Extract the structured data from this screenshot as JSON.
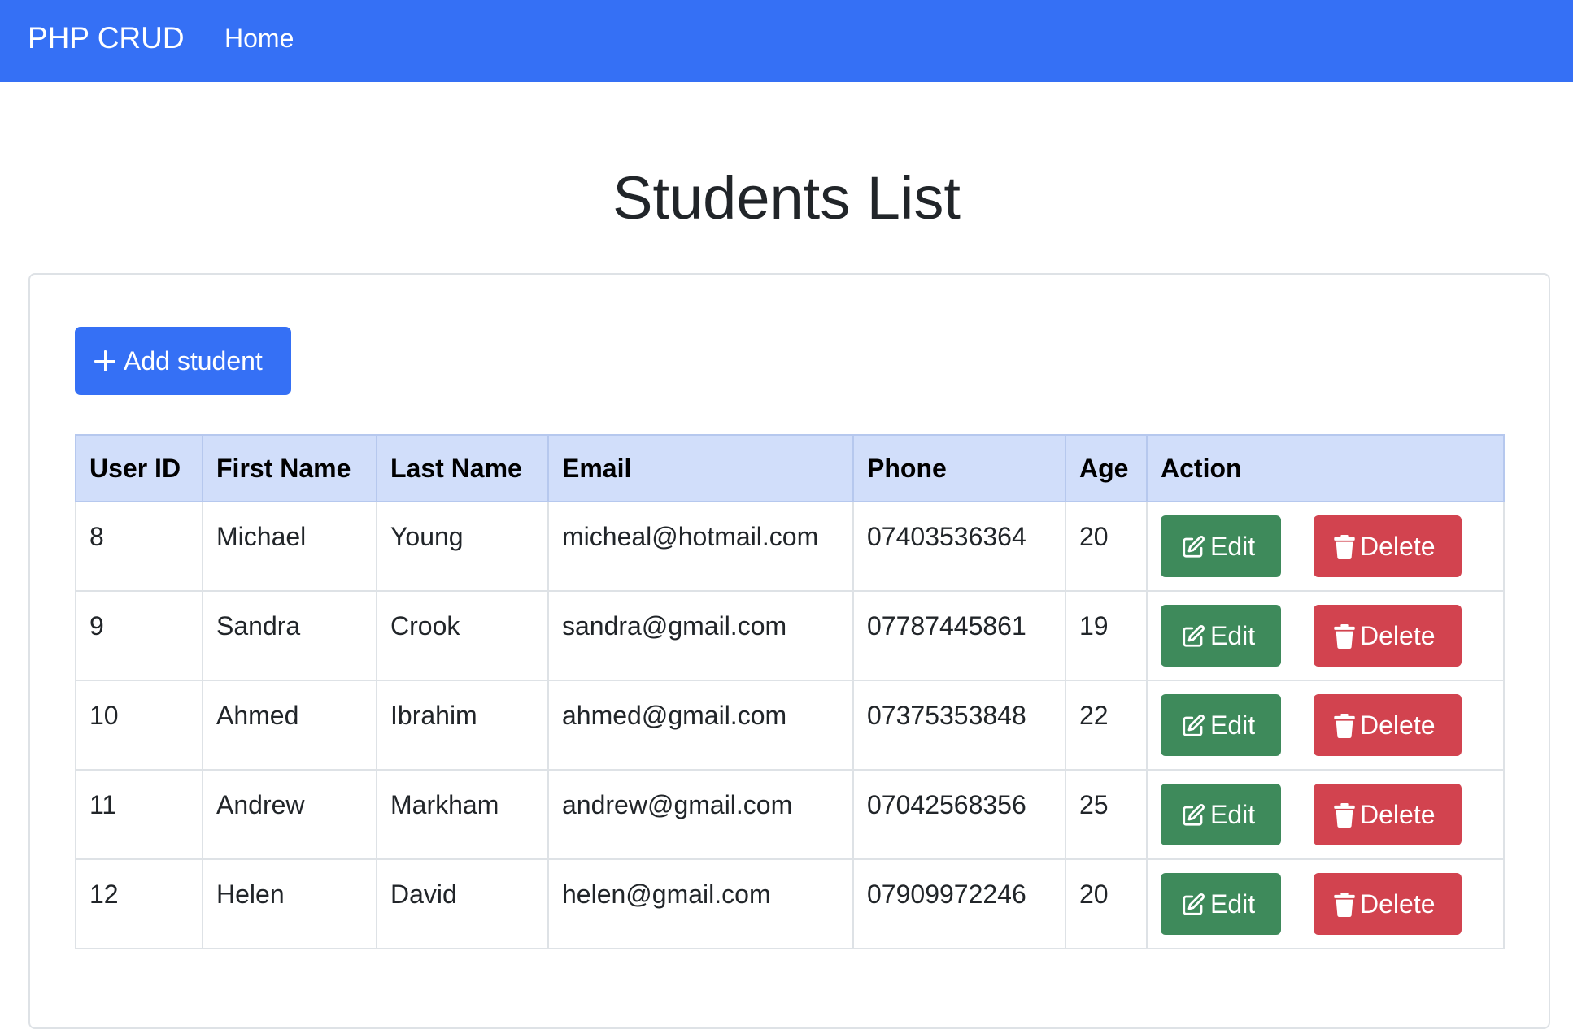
{
  "navbar": {
    "brand": "PHP CRUD",
    "home": "Home",
    "background": "#3570f5"
  },
  "page": {
    "title": "Students List"
  },
  "add_button": {
    "label": "Add student",
    "icon": "plus-icon"
  },
  "table": {
    "headers": [
      "User ID",
      "First Name",
      "Last Name",
      "Email",
      "Phone",
      "Age",
      "Action"
    ],
    "rows": [
      {
        "id": "8",
        "first": "Michael",
        "last": "Young",
        "email": "micheal@hotmail.com",
        "phone": "07403536364",
        "age": "20"
      },
      {
        "id": "9",
        "first": "Sandra",
        "last": "Crook",
        "email": "sandra@gmail.com",
        "phone": "07787445861",
        "age": "19"
      },
      {
        "id": "10",
        "first": "Ahmed",
        "last": "Ibrahim",
        "email": "ahmed@gmail.com",
        "phone": "07375353848",
        "age": "22"
      },
      {
        "id": "11",
        "first": "Andrew",
        "last": "Markham",
        "email": "andrew@gmail.com",
        "phone": "07042568356",
        "age": "25"
      },
      {
        "id": "12",
        "first": "Helen",
        "last": "David",
        "email": "helen@gmail.com",
        "phone": "07909972246",
        "age": "20"
      }
    ],
    "actions": {
      "edit_label": "Edit",
      "edit_icon": "edit-icon",
      "edit_color": "#3e8a5b",
      "delete_label": "Delete",
      "delete_icon": "trash-icon",
      "delete_color": "#d2434f"
    }
  }
}
